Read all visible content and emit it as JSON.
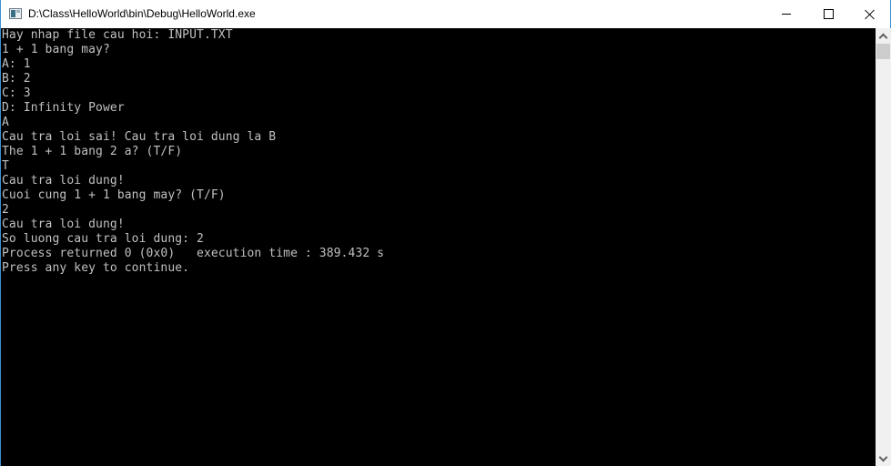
{
  "window": {
    "title": "D:\\Class\\HelloWorld\\bin\\Debug\\HelloWorld.exe",
    "icon": "console-app-icon",
    "controls": {
      "minimize": "minimize-icon",
      "maximize": "maximize-icon",
      "close": "close-icon"
    }
  },
  "console": {
    "lines": [
      "Hay nhap file cau hoi: INPUT.TXT",
      "1 + 1 bang may?",
      "A: 1",
      "B: 2",
      "C: 3",
      "D: Infinity Power",
      "A",
      "Cau tra loi sai! Cau tra loi dung la B",
      "The 1 + 1 bang 2 a? (T/F)",
      "T",
      "Cau tra loi dung!",
      "Cuoi cung 1 + 1 bang may? (T/F)",
      "2",
      "Cau tra loi dung!",
      "So luong cau tra loi dung: 2",
      "Process returned 0 (0x0)   execution time : 389.432 s",
      "Press any key to continue."
    ]
  },
  "scrollbar": {
    "up": "chevron-up-icon",
    "down": "chevron-down-icon"
  }
}
